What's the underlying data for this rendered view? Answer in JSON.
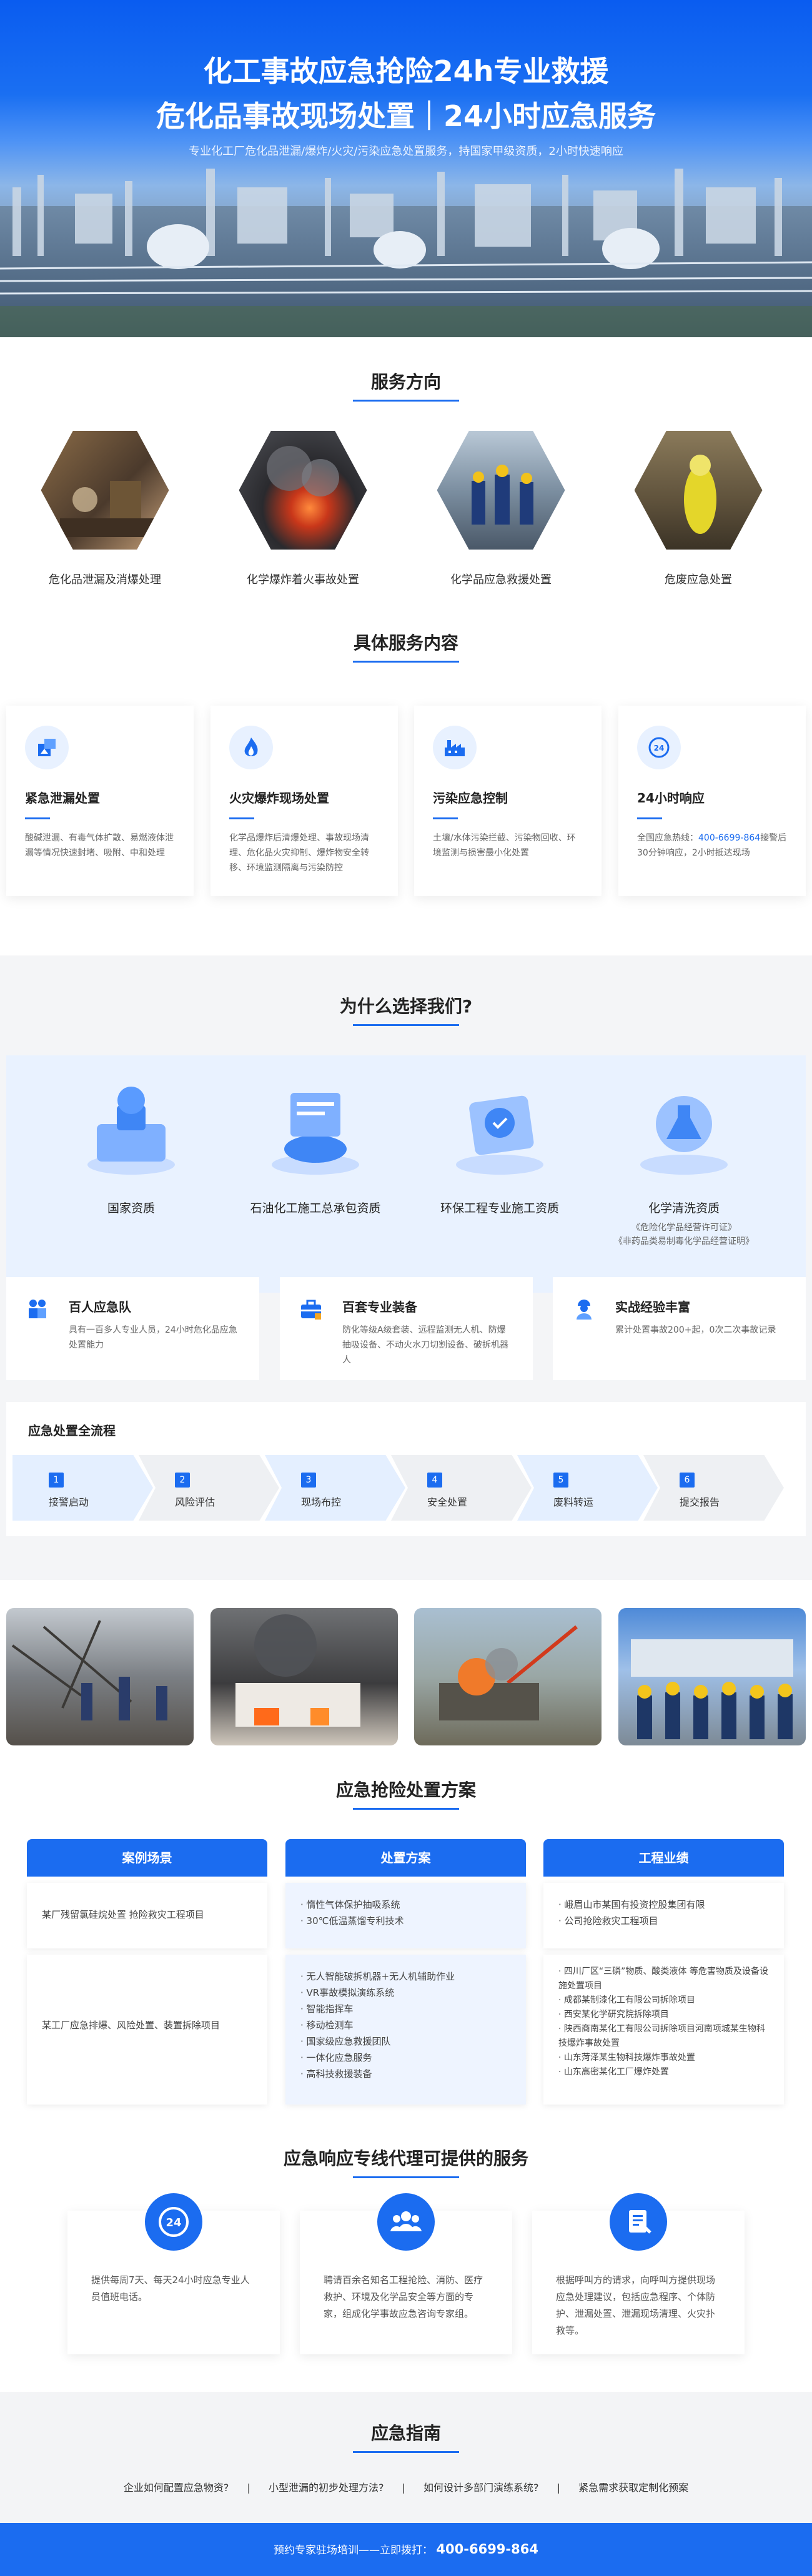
{
  "hero": {
    "title_line1": "化工事故应急抢险24h专业救援",
    "title_line2": "危化品事故现场处置｜24小时应急服务",
    "subtitle": "专业化工厂危化品泄漏/爆炸/火灾/污染应急处置服务，持国家甲级资质，2小时快速响应"
  },
  "service_direction": {
    "title": "服务方向",
    "items": [
      {
        "label": "危化品泄漏及消爆处理"
      },
      {
        "label": "化学爆炸着火事故处置"
      },
      {
        "label": "化学品应急救援处置"
      },
      {
        "label": "危废应急处置"
      }
    ]
  },
  "service_content": {
    "title": "具体服务内容",
    "cards": [
      {
        "title": "紧急泄漏处置",
        "desc": "酸碱泄漏、有毒气体扩散、易燃液体泄漏等情况快速封堵、吸附、中和处理",
        "icon": "leak-icon"
      },
      {
        "title": "火灾爆炸现场处置",
        "desc": "化学品爆炸后清爆处理、事故现场清理、危化品火灾抑制、爆炸物安全转移、环境监测隔离与污染防控",
        "icon": "fire-icon"
      },
      {
        "title": "污染应急控制",
        "desc": "土壤/水体污染拦截、污染物回收、环境监测与损害最小化处置",
        "icon": "factory-icon"
      },
      {
        "title": "24小时响应",
        "desc_prefix": "全国应急热线：",
        "phone": "400-6699-864",
        "desc_suffix": "接警后30分钟响应，2小时抵达现场",
        "icon": "clock-24-icon"
      }
    ]
  },
  "why": {
    "title": "为什么选择我们?",
    "qualifications": [
      {
        "name": "国家资质",
        "sub": ""
      },
      {
        "name": "石油化工施工总承包资质",
        "sub": ""
      },
      {
        "name": "环保工程专业施工资质",
        "sub": ""
      },
      {
        "name": "化学清洗资质",
        "sub1": "《危险化学品经营许可证》",
        "sub2": "《非药品类易制毒化学品经营证明》"
      }
    ],
    "features": [
      {
        "title": "百人应急队",
        "desc": "具有一百多人专业人员，24小时危化品应急处置能力",
        "icon": "team-icon"
      },
      {
        "title": "百套专业装备",
        "desc": "防化等级A级套装、远程监测无人机、防爆抽吸设备、不动火水刀切割设备、破拆机器人",
        "icon": "toolbox-icon"
      },
      {
        "title": "实战经验丰富",
        "desc": "累计处置事故200+起，0次二次事故记录",
        "icon": "worker-icon"
      }
    ],
    "flow": {
      "title": "应急处置全流程",
      "steps": [
        {
          "num": "1",
          "label": "接警启动"
        },
        {
          "num": "2",
          "label": "风险评估"
        },
        {
          "num": "3",
          "label": "现场布控"
        },
        {
          "num": "4",
          "label": "安全处置"
        },
        {
          "num": "5",
          "label": "废料转运"
        },
        {
          "num": "6",
          "label": "提交报告"
        }
      ]
    }
  },
  "plan": {
    "title": "应急抢险处置方案",
    "headers": [
      "案例场景",
      "处置方案",
      "工程业绩"
    ],
    "rows": [
      {
        "scene": "某厂残留氯硅烷处置 抢险救灾工程项目",
        "solution": [
          "· 惰性气体保护抽吸系统",
          "· 30℃低温蒸馏专利技术"
        ],
        "records": [
          "· 峨眉山市某国有投资控股集团有限",
          "· 公司抢险救灾工程项目"
        ]
      },
      {
        "scene": "某工厂应急排爆、风险处置、装置拆除项目",
        "solution": [
          "· 无人智能破拆机器+无人机辅助作业",
          "· VR事故模拟演练系统",
          "· 智能指挥车",
          "· 移动检测车",
          "· 国家级应急救援团队",
          "· 一体化应急服务",
          "· 高科技救援装备"
        ],
        "records": [
          "· 四川厂区“三磷”物质、酸类液体 等危害物质及设备设施处置项目",
          "· 成都某制漆化工有限公司拆除项目",
          "· 西安某化学研究院拆除项目",
          "· 陕西商南某化工有限公司拆除项目河南项城某生物科技爆炸事故处置",
          "· 山东菏泽某生物科技爆炸事故处置",
          "· 山东高密某化工厂爆炸处置"
        ]
      }
    ]
  },
  "agent": {
    "title": "应急响应专线代理可提供的服务",
    "cards": [
      {
        "desc": "提供每周7天、每天24小时应急专业人员值班电话。",
        "icon": "clock-24-icon"
      },
      {
        "desc": "聘请百余名知名工程抢险、消防、医疗救护、环境及化学品安全等方面的专家，组成化学事故应急咨询专家组。",
        "icon": "group-icon"
      },
      {
        "desc": "根据呼叫方的请求，向呼叫方提供现场应急处理建议，包括应急程序、个体防护、泄漏处置、泄漏现场清理、火灾扑救等。",
        "icon": "document-icon"
      }
    ]
  },
  "guide": {
    "title": "应急指南",
    "links": [
      "企业如何配置应急物资?",
      "小型泄漏的初步处理方法?",
      "如何设计多部门演练系统?",
      "紧急需求获取定制化预案"
    ],
    "separator": "|"
  },
  "footer": {
    "text": "预约专家驻场培训——立即拨打：",
    "phone": "400-6699-864"
  },
  "colors": {
    "primary": "#1b6cf0",
    "light_bg": "#e9f2ff",
    "gray_bg": "#f4f5f7"
  }
}
